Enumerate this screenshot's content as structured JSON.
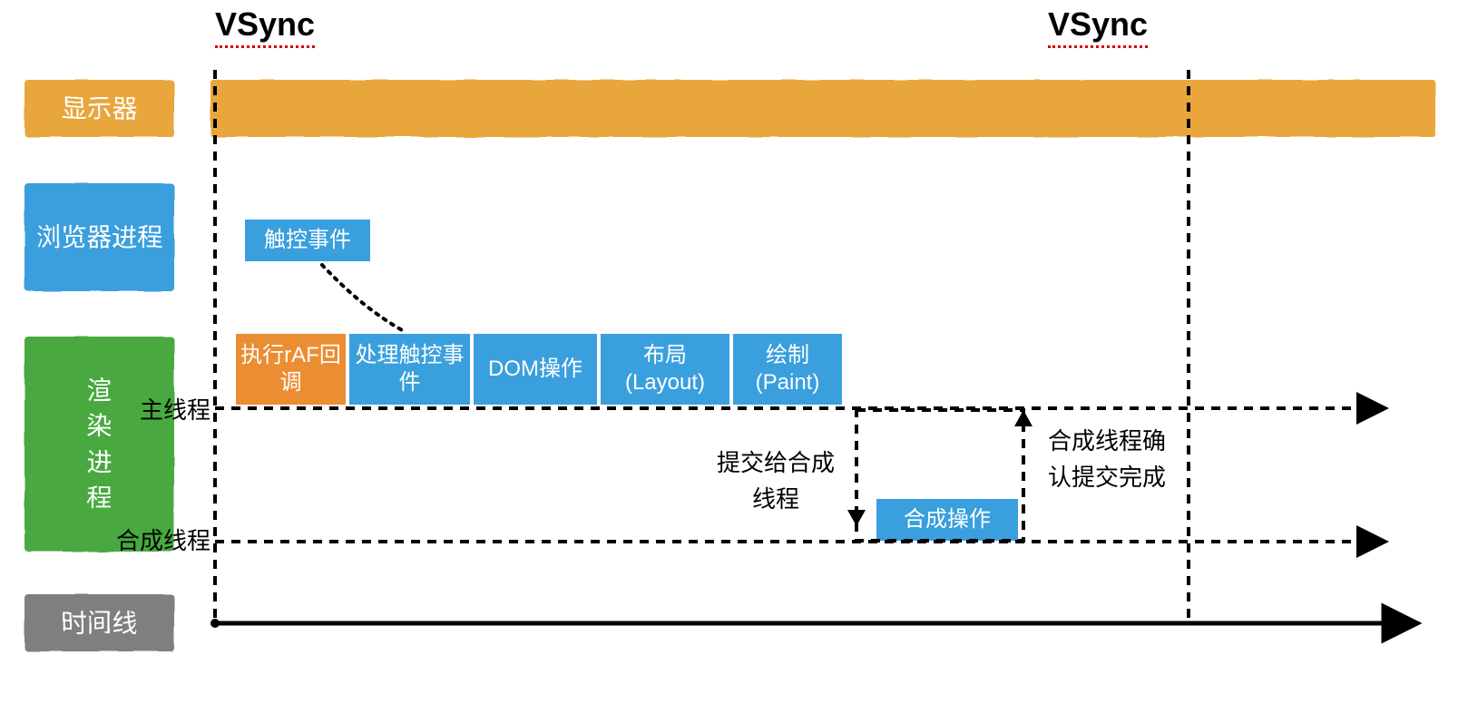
{
  "vsync_label": "VSync",
  "rows": {
    "display": "显示器",
    "browser": "浏览器进程",
    "renderer": "渲染进程",
    "timeline": "时间线"
  },
  "threads": {
    "main": "主线程",
    "compositor": "合成线程"
  },
  "tasks": {
    "touch_event": "触控事件",
    "raf": "执行rAF回调",
    "handle_touch": "处理触控事件",
    "dom_ops": "DOM操作",
    "layout": "布局\n(Layout)",
    "paint": "绘制\n(Paint)",
    "composite": "合成操作"
  },
  "notes": {
    "commit": "提交给合成线程",
    "confirm": "合成线程确认提交完成"
  },
  "colors": {
    "yellow": "#e9a63e",
    "blue": "#3a9fdd",
    "orange": "#eb8d32",
    "green": "#4aa93f",
    "grey": "#7f7f7f"
  }
}
